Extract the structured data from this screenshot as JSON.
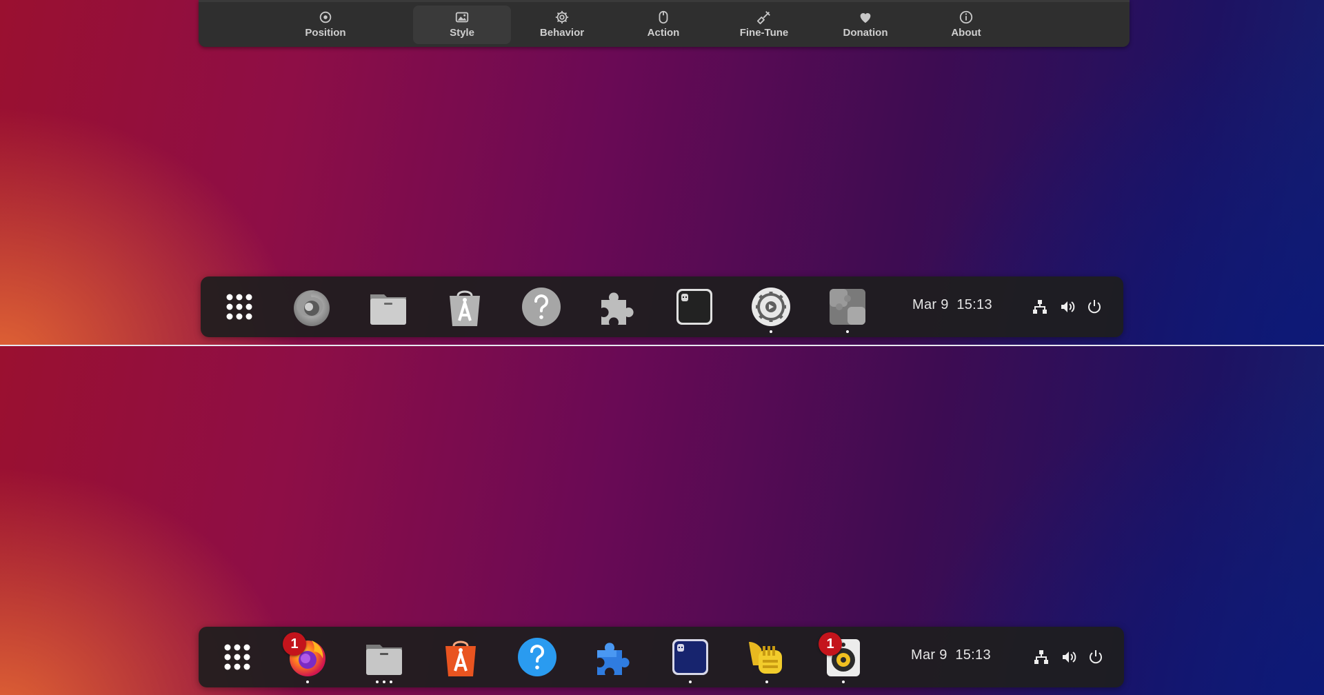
{
  "tabs": [
    {
      "label": "Position",
      "icon": "position-icon"
    },
    {
      "label": "Style",
      "icon": "style-icon",
      "active": true
    },
    {
      "label": "Behavior",
      "icon": "behavior-icon"
    },
    {
      "label": "Action",
      "icon": "mouse-icon"
    },
    {
      "label": "Fine-Tune",
      "icon": "fine-tune-icon"
    },
    {
      "label": "Donation",
      "icon": "heart-icon"
    },
    {
      "label": "About",
      "icon": "info-icon"
    }
  ],
  "dock_top": {
    "style": "monochrome",
    "apps": [
      "show-apps-icon",
      "firefox-icon",
      "files-icon",
      "app-center-icon",
      "help-icon",
      "extensions-icon",
      "terminal-icon",
      "settings-icon",
      "extension-manager-icon"
    ],
    "clock": "Mar 9  15:13",
    "tray": [
      "network-icon",
      "volume-icon",
      "power-icon"
    ]
  },
  "dock_bottom": {
    "style": "color",
    "apps": [
      "show-apps-icon",
      "firefox-icon",
      "files-icon",
      "app-center-icon",
      "help-icon",
      "extensions-icon",
      "terminal-icon",
      "tuba-icon",
      "rhythmbox-icon"
    ],
    "badges": {
      "firefox": "1",
      "rhythmbox": "1"
    },
    "clock": "Mar 9  15:13",
    "tray": [
      "network-icon",
      "volume-icon",
      "power-icon"
    ]
  },
  "colors": {
    "accent_orange": "#e95420",
    "badge_red": "#c4141c",
    "dock_bg": "#1e1e1e"
  }
}
